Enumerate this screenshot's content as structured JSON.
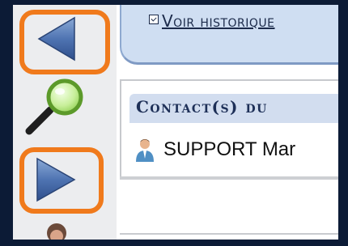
{
  "history_panel": {
    "link_label": "Voir historique"
  },
  "toolbar": {
    "back_icon": "left-arrow-icon",
    "zoom_icon": "magnifier-icon",
    "forward_icon": "right-arrow-icon",
    "highlight_color": "#f07a1c"
  },
  "contacts": {
    "title": "Contact(s) du",
    "items": [
      {
        "name": "SUPPORT Mar",
        "icon": "person-icon"
      }
    ]
  }
}
